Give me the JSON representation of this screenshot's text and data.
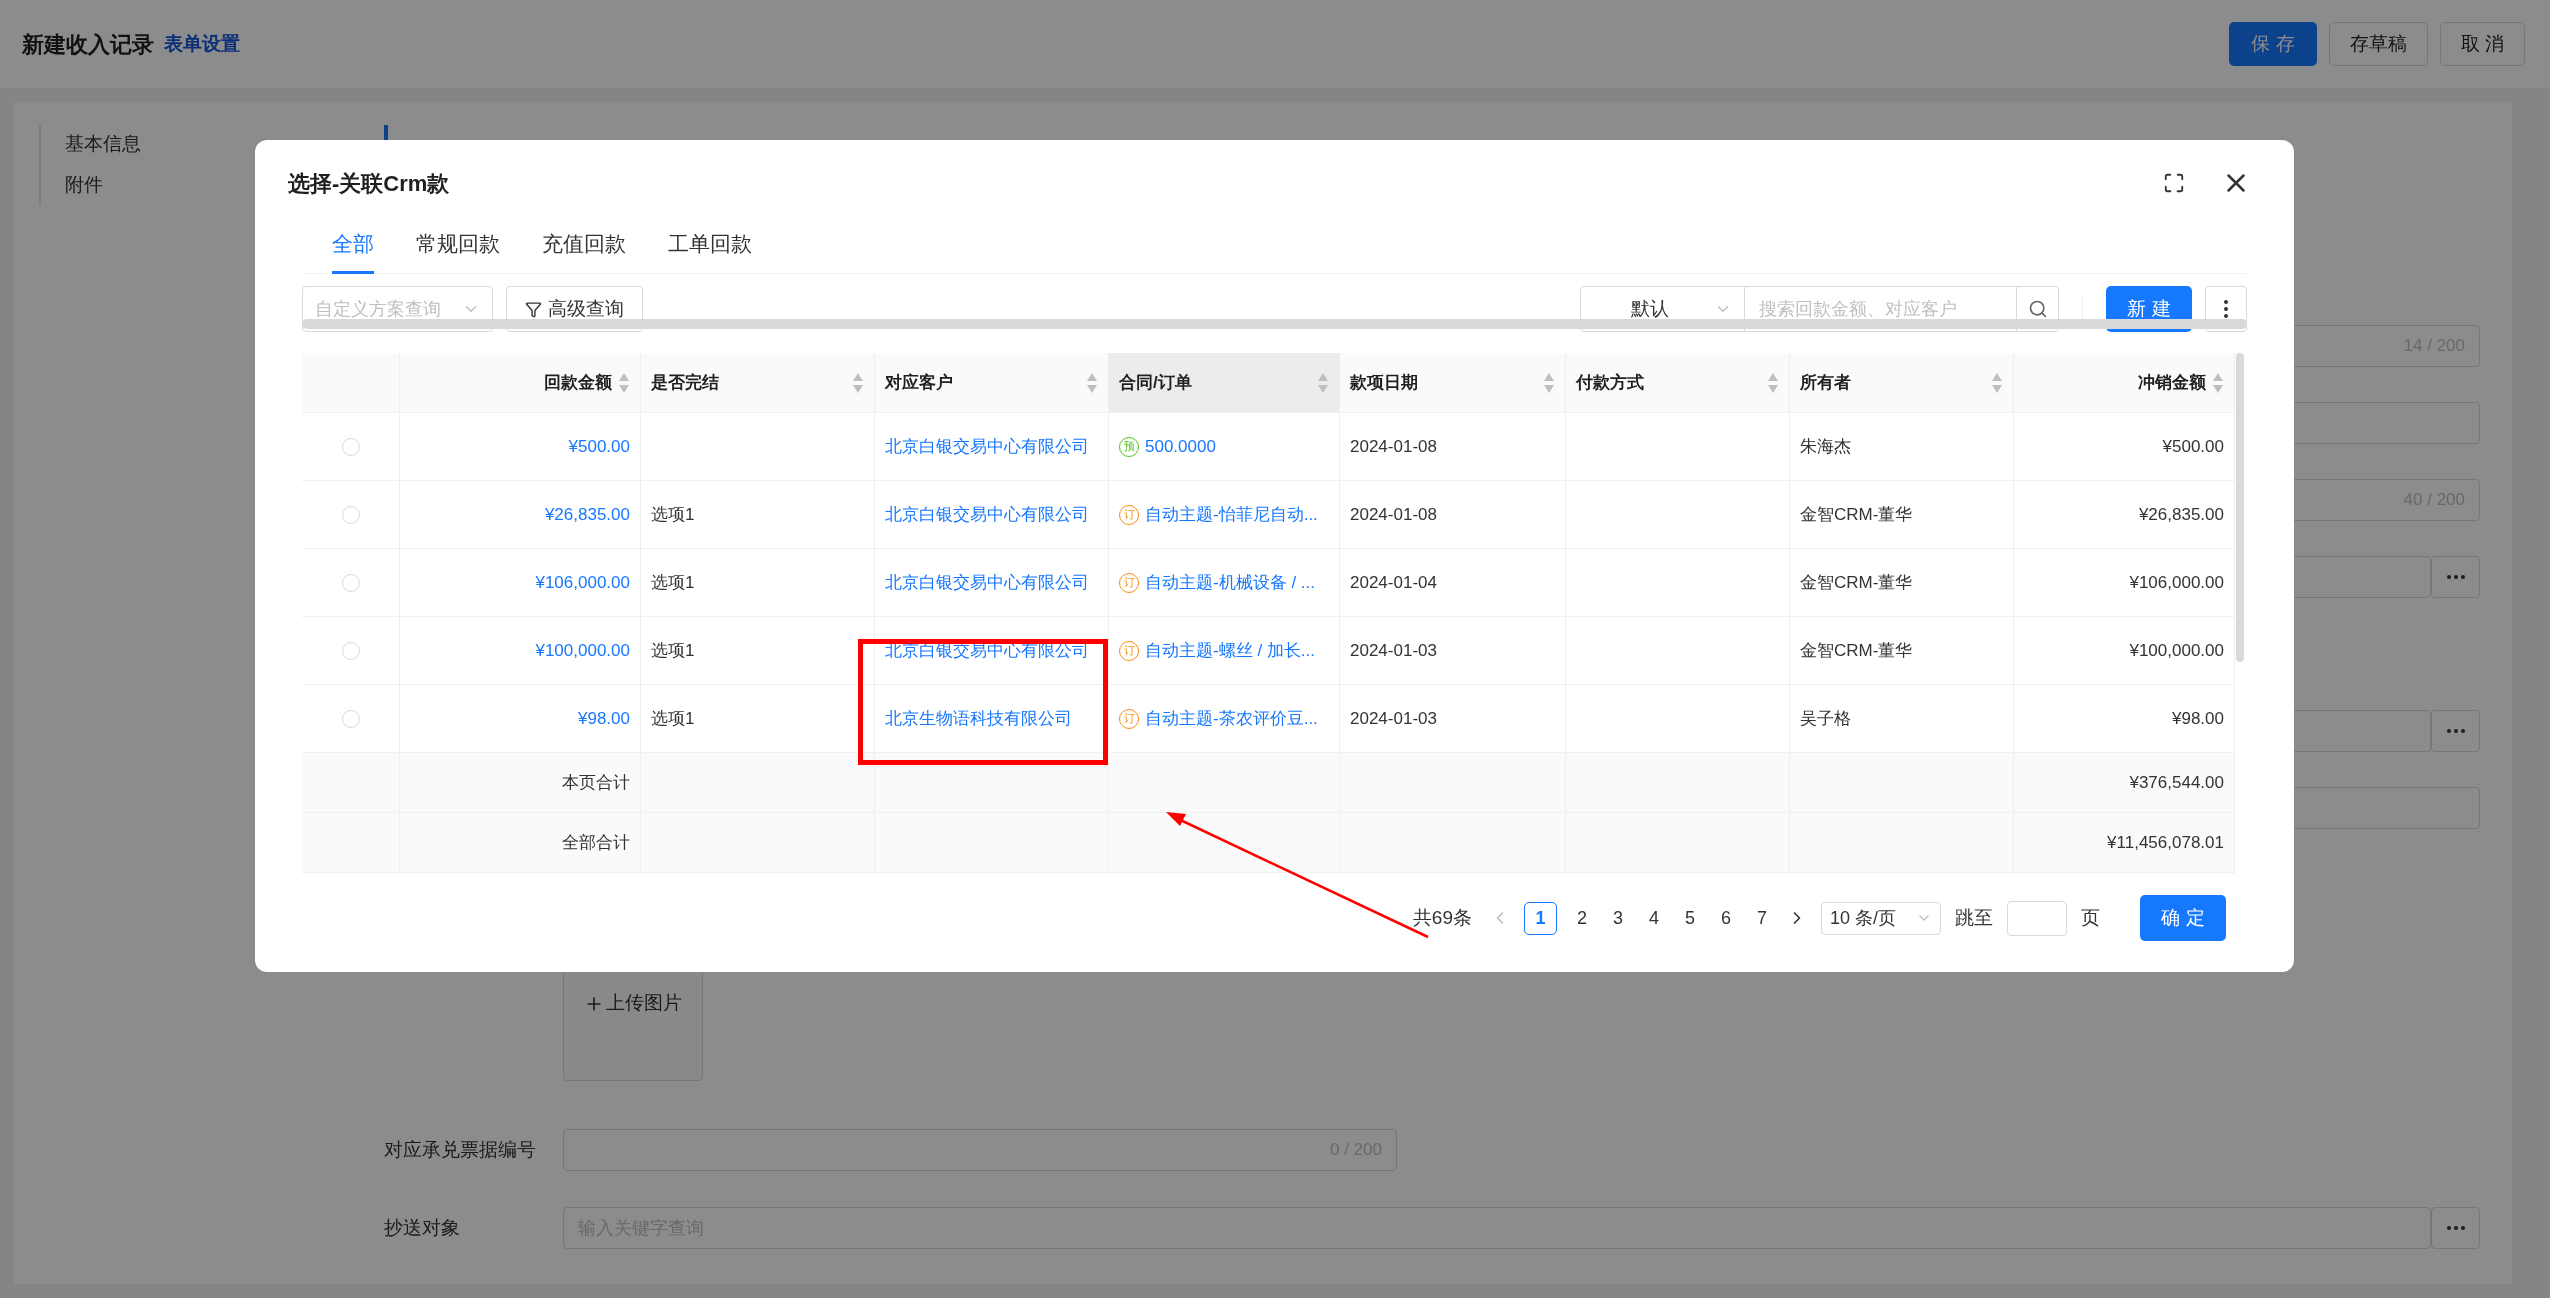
{
  "page": {
    "title": "新建收入记录",
    "settings_link": "表单设置",
    "buttons": [
      {
        "label": "保 存",
        "kind": "primary"
      },
      {
        "label": "存草稿",
        "kind": "default"
      },
      {
        "label": "取 消",
        "kind": "default"
      }
    ]
  },
  "nav": [
    {
      "label": "基本信息",
      "selected": false
    },
    {
      "label": "附件",
      "selected": false
    }
  ],
  "fields": [
    {
      "kind": "counter",
      "counter": "14 / 200"
    },
    {
      "kind": "plain"
    },
    {
      "kind": "counter",
      "counter": "40 / 200"
    },
    {
      "kind": "more"
    },
    {
      "kind": "more"
    },
    {
      "kind": "plain"
    }
  ],
  "upload": {
    "label": "上传图片"
  },
  "bill_field": {
    "label": "对应承兑票据编号",
    "counter": "0 / 200"
  },
  "cc_field": {
    "label": "抄送对象",
    "placeholder": "输入关键字查询"
  },
  "dialog": {
    "title": "选择-关联Crm款",
    "tabs": [
      {
        "label": "全部",
        "selected": true
      },
      {
        "label": "常规回款",
        "selected": false
      },
      {
        "label": "充值回款",
        "selected": false
      },
      {
        "label": "工单回款",
        "selected": false
      }
    ],
    "scheme_select": {
      "placeholder": "自定义方案查询"
    },
    "advanced_button": "高级查询",
    "sort_select": "默认",
    "search": {
      "placeholder": "搜索回款金额、对应客户"
    },
    "new_button": "新 建",
    "table": {
      "columns": [
        {
          "label": "回款金额",
          "highlighted": false
        },
        {
          "label": "是否完结",
          "highlighted": false
        },
        {
          "label": "对应客户",
          "highlighted": false
        },
        {
          "label": "合同/订单",
          "highlighted": true
        },
        {
          "label": "款项日期",
          "highlighted": false
        },
        {
          "label": "付款方式",
          "highlighted": false
        },
        {
          "label": "所有者",
          "highlighted": false
        },
        {
          "label": "冲销金额",
          "highlighted": false
        }
      ],
      "rows": [
        {
          "selected": false,
          "amount": "¥500.00",
          "customer": "北京白银交易中心有限公司",
          "order": {
            "kind": "prepay",
            "badge": "预",
            "text": "500.0000"
          },
          "date": "2024-01-08",
          "owner": "朱海杰",
          "writeoff": "¥500.00"
        },
        {
          "selected": false,
          "amount": "¥26,835.00",
          "finished": "选项1",
          "customer": "北京白银交易中心有限公司",
          "order": {
            "kind": "order",
            "badge": "订",
            "text": "自动主题-怡菲尼自动..."
          },
          "date": "2024-01-08",
          "owner": "金智CRM-董华",
          "writeoff": "¥26,835.00"
        },
        {
          "selected": false,
          "amount": "¥106,000.00",
          "finished": "选项1",
          "customer": "北京白银交易中心有限公司",
          "order": {
            "kind": "order",
            "badge": "订",
            "text": "自动主题-机械设备 / ..."
          },
          "date": "2024-01-04",
          "owner": "金智CRM-董华",
          "writeoff": "¥106,000.00"
        },
        {
          "selected": false,
          "amount": "¥100,000.00",
          "finished": "选项1",
          "customer": "北京白银交易中心有限公司",
          "order": {
            "kind": "order",
            "badge": "订",
            "text": "自动主题-螺丝 / 加长..."
          },
          "date": "2024-01-03",
          "owner": "金智CRM-董华",
          "writeoff": "¥100,000.00"
        },
        {
          "selected": false,
          "amount": "¥98.00",
          "finished": "选项1",
          "customer": "北京生物语科技有限公司",
          "order": {
            "kind": "order",
            "badge": "订",
            "text": "自动主题-茶农评价豆..."
          },
          "date": "2024-01-03",
          "owner": "吴子格",
          "writeoff": "¥98.00"
        }
      ],
      "summary": [
        {
          "label": "本页合计",
          "writeoff": "¥376,544.00"
        },
        {
          "label": "全部合计",
          "writeoff": "¥11,456,078.01"
        }
      ]
    },
    "pagination": {
      "total": "共69条",
      "pages": [
        {
          "label": "1",
          "selected": true
        },
        {
          "label": "2",
          "selected": false
        },
        {
          "label": "3",
          "selected": false
        },
        {
          "label": "4",
          "selected": false
        },
        {
          "label": "5",
          "selected": false
        },
        {
          "label": "6",
          "selected": false
        },
        {
          "label": "7",
          "selected": false
        }
      ],
      "page_size": "10 条/页",
      "jump_label": "跳至",
      "page_unit": "页"
    },
    "confirm_button": "确 定"
  }
}
